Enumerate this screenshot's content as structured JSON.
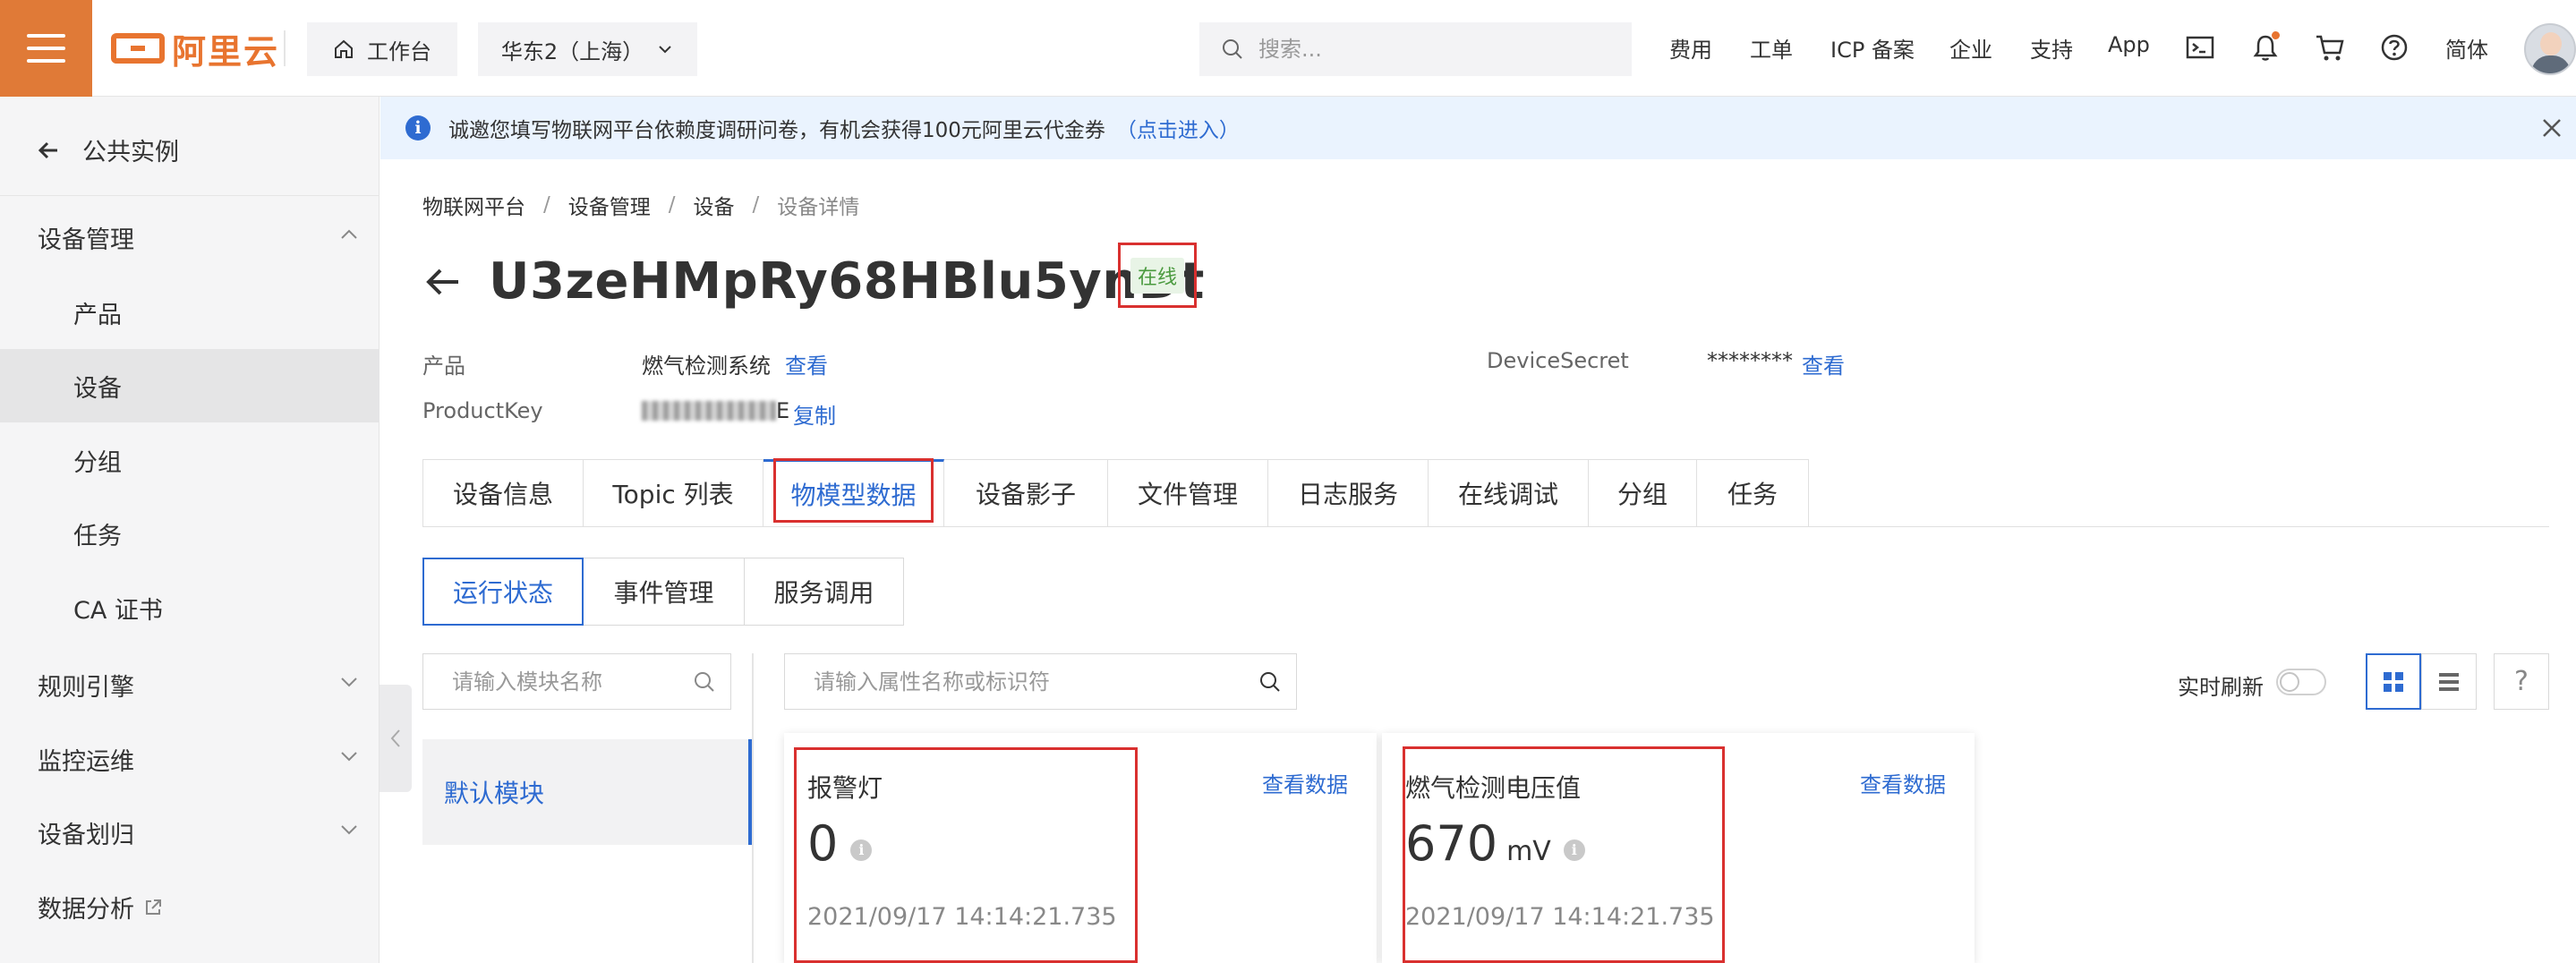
{
  "topbar": {
    "logo_text": "阿里云",
    "workbench": "工作台",
    "region": "华东2（上海）",
    "search_placeholder": "搜索...",
    "nav": [
      "费用",
      "工单",
      "ICP 备案",
      "企业",
      "支持",
      "App"
    ],
    "language": "简体",
    "accent_color": "#e07a37"
  },
  "sidebar": {
    "back_label": "公共实例",
    "groups": {
      "device_mgmt": "设备管理",
      "rules": "规则引擎",
      "monitor": "监控运维",
      "device_assign": "设备划归",
      "analytics": "数据分析"
    },
    "items": [
      "产品",
      "设备",
      "分组",
      "任务",
      "CA 证书"
    ],
    "active_item": "设备"
  },
  "notice": {
    "text": "诚邀您填写物联网平台依赖度调研问卷，有机会获得100元阿里云代金券",
    "link": "（点击进入）"
  },
  "breadcrumb": [
    "物联网平台",
    "设备管理",
    "设备",
    "设备详情"
  ],
  "device": {
    "name": "U3zeHMpRy68HBlu5ynDt",
    "status": "在线",
    "product_label": "产品",
    "product_value": "燃气检测系统",
    "product_link": "查看",
    "productkey_label": "ProductKey",
    "productkey_tail": "E",
    "productkey_link": "复制",
    "secret_label": "DeviceSecret",
    "secret_value": "********",
    "secret_link": "查看"
  },
  "tabs": [
    "设备信息",
    "Topic 列表",
    "物模型数据",
    "设备影子",
    "文件管理",
    "日志服务",
    "在线调试",
    "分组",
    "任务"
  ],
  "active_tab": "物模型数据",
  "subtabs": [
    "运行状态",
    "事件管理",
    "服务调用"
  ],
  "active_subtab": "运行状态",
  "module_search_placeholder": "请输入模块名称",
  "property_search_placeholder": "请输入属性名称或标识符",
  "module_item": "默认模块",
  "realtime_refresh_label": "实时刷新",
  "help_label": "?",
  "cards": [
    {
      "title": "报警灯",
      "value": "0",
      "unit": "",
      "time": "2021/09/17 14:14:21.735",
      "link": "查看数据"
    },
    {
      "title": "燃气检测电压值",
      "value": "670",
      "unit": "mV",
      "time": "2021/09/17 14:14:21.735",
      "link": "查看数据"
    }
  ],
  "colors": {
    "link": "#2e6bd1",
    "highlight": "#d9302f",
    "online_bg": "#e8f4e6",
    "online_text": "#4a9a3f"
  }
}
